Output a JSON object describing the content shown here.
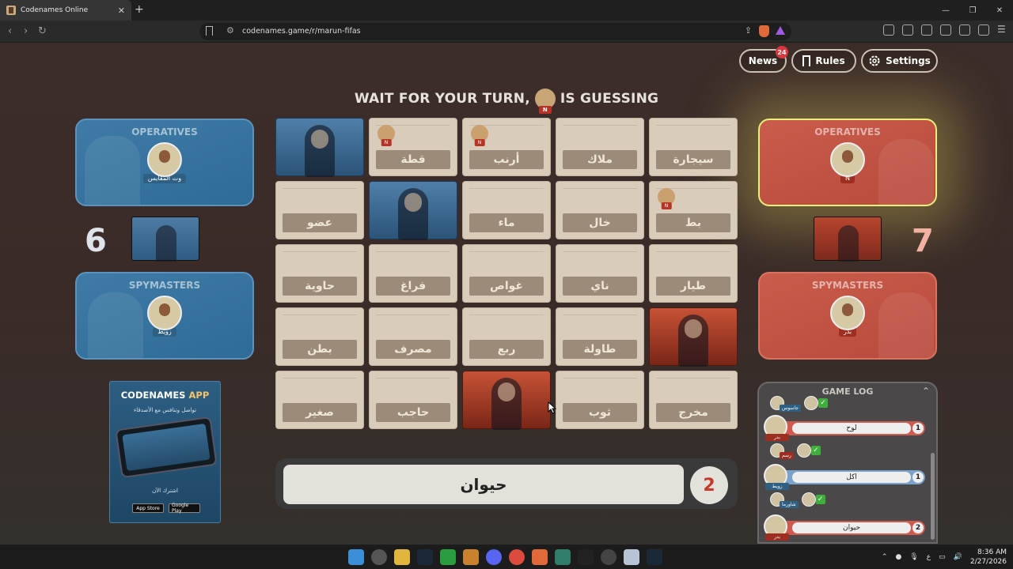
{
  "browser": {
    "tab_title": "Codenames Online",
    "url": "codenames.game/r/marun-fifas"
  },
  "topbar": {
    "news_label": "News",
    "news_count": "24",
    "rules_label": "Rules",
    "settings_label": "Settings"
  },
  "banner": {
    "prefix": "WAIT FOR YOUR TURN,",
    "avatar_tag": "N",
    "suffix": "IS GUESSING"
  },
  "blue_team": {
    "color": "#3a78a6",
    "score": "6",
    "operatives_title": "OPERATIVES",
    "operative_name": "وت المقايس",
    "spymasters_title": "SPYMASTERS",
    "spymaster_name": "زويط"
  },
  "red_team": {
    "color": "#c4533f",
    "score": "7",
    "operatives_title": "OPERATIVES",
    "operative_name": "N",
    "spymasters_title": "SPYMASTERS",
    "spymaster_name": "بدر"
  },
  "board": {
    "cards": [
      {
        "word": "",
        "state": "agent-blue"
      },
      {
        "word": "قطة",
        "state": "neutral",
        "marker": "N"
      },
      {
        "word": "أرنب",
        "state": "neutral",
        "marker": "N"
      },
      {
        "word": "ملاك",
        "state": "neutral"
      },
      {
        "word": "سيجارة",
        "state": "neutral"
      },
      {
        "word": "عضو",
        "state": "neutral"
      },
      {
        "word": "",
        "state": "agent-blue"
      },
      {
        "word": "ماء",
        "state": "neutral"
      },
      {
        "word": "خال",
        "state": "neutral"
      },
      {
        "word": "بط",
        "state": "neutral",
        "marker": "N"
      },
      {
        "word": "حاوية",
        "state": "neutral"
      },
      {
        "word": "فراغ",
        "state": "neutral"
      },
      {
        "word": "غواص",
        "state": "neutral"
      },
      {
        "word": "ناي",
        "state": "neutral"
      },
      {
        "word": "طيار",
        "state": "neutral"
      },
      {
        "word": "بطن",
        "state": "neutral"
      },
      {
        "word": "مصرف",
        "state": "neutral"
      },
      {
        "word": "ربع",
        "state": "neutral"
      },
      {
        "word": "طاولة",
        "state": "neutral"
      },
      {
        "word": "",
        "state": "agent-red"
      },
      {
        "word": "صغير",
        "state": "neutral"
      },
      {
        "word": "حاجب",
        "state": "neutral"
      },
      {
        "word": "",
        "state": "agent-red"
      },
      {
        "word": "ثوب",
        "state": "neutral"
      },
      {
        "word": "مخرج",
        "state": "neutral"
      }
    ]
  },
  "clue": {
    "word": "حيوان",
    "number": "2"
  },
  "app_ad": {
    "title_main": "CODENAMES",
    "title_accent": "APP",
    "subtitle": "تواصل وتنافس مع الأصدقاء",
    "cta": "اشترك الآن",
    "app_store": "App Store",
    "google_play": "Google Play"
  },
  "game_log": {
    "title": "GAME LOG",
    "top_guess_name": "جاسوس",
    "entries": [
      {
        "team": "red",
        "player": "بدر",
        "word": "لوح",
        "number": "1"
      },
      {
        "team": "blue",
        "player": "زويط",
        "word": "اكل",
        "number": "1"
      },
      {
        "team": "red",
        "player": "بدر",
        "word": "حيوان",
        "number": "2"
      }
    ],
    "guess_red_name": "رسم",
    "guess_blue_name": "شاورما"
  },
  "taskbar": {
    "time": "8:36 AM",
    "date": "2/27/2026",
    "lang": "ع"
  }
}
